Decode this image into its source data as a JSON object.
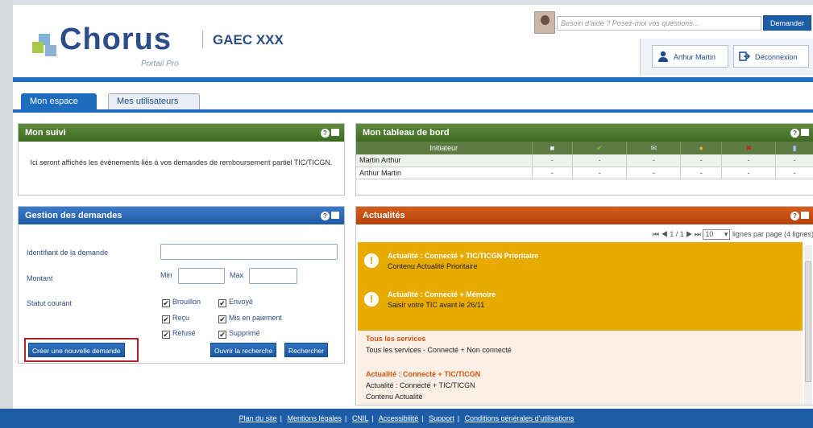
{
  "header": {
    "logo_word": "Chorus",
    "logo_sub": "Portail Pro",
    "company": "GAEC XXX",
    "help_placeholder": "Besoin d'aide ? Posez-moi vos questions...",
    "help_button": "Demander",
    "user_name": "Arthur Martin",
    "logout": "Déconnexion"
  },
  "tabs": [
    {
      "label": "Mon espace",
      "active": true
    },
    {
      "label": "Mes utilisateurs",
      "active": false
    }
  ],
  "suivi": {
    "title": "Mon suivi",
    "text": "Ici seront affichés les évènements liés à vos demandes de remboursement partiel TIC/TICGN."
  },
  "tableau": {
    "title": "Mon tableau de bord",
    "col_initiateur": "Initiateur",
    "icons": [
      "document-icon",
      "check-icon",
      "mail-icon",
      "coins-icon",
      "cancel-icon",
      "trash-icon"
    ],
    "icon_colors": [
      "#ffffff",
      "#6fce3a",
      "#cfe4f7",
      "#e7b82a",
      "#d02020",
      "#9dc7ef"
    ],
    "rows": [
      {
        "name": "Martin Arthur",
        "values": [
          "-",
          "-",
          "-",
          "-",
          "-",
          "-"
        ]
      },
      {
        "name": "Arthur Martin",
        "values": [
          "-",
          "-",
          "-",
          "-",
          "-",
          "-"
        ]
      }
    ]
  },
  "gestion": {
    "title": "Gestion des demandes",
    "id_label": "Identifiant de la demande",
    "montant_label": "Montant",
    "min_label": "Min",
    "max_label": "Max",
    "statut_label": "Statut courant",
    "checks": [
      "Brouillon",
      "Envoyé",
      "Reçu",
      "Mis en paiement",
      "Refusé",
      "Supprimé"
    ],
    "create_btn": "Créer une nouvelle demande",
    "open_btn": "Ouvrir la recherche",
    "search_btn": "Rechercher"
  },
  "actualites": {
    "title": "Actualités",
    "pager_text": "1 / 1",
    "per_page": "10",
    "per_page_label": "lignes par page (4 lignes)",
    "priority": [
      {
        "title": "Actualité : Connecté + TIC/TICGN Prioritaire",
        "text": "Contenu Actualité Prioritaire"
      },
      {
        "title": "Actualité : Connecté + Mémoire",
        "text": "Saisir votre TIC avant le 26/11"
      }
    ],
    "normal": [
      {
        "title": "Tous les services",
        "text": "Tous les services - Connecté + Non connecté"
      },
      {
        "title": "Actualité : Connecté + TIC/TICGN",
        "text": "Actualité : Connecté + TIC/TICGN",
        "text2": "Contenu Actualité"
      }
    ]
  },
  "footer": {
    "links": [
      "Plan du site",
      "Mentions légales",
      "CNIL",
      "Accessibilité",
      "Support",
      "Conditions générales d'utilisations"
    ]
  },
  "colors": {
    "accent_blue": "#1d5da8",
    "green": "#4a7a2e",
    "orange": "#c44e12",
    "yellow": "#e7ab00",
    "red_outline": "#b2202a"
  }
}
